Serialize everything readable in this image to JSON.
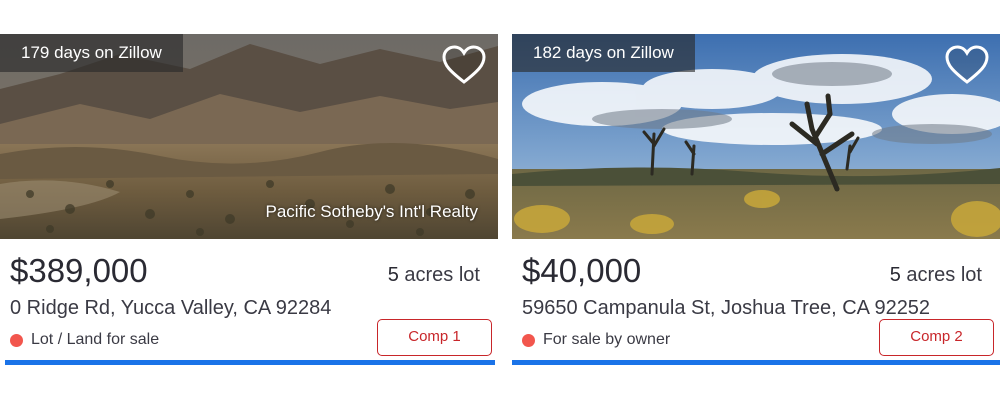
{
  "listings": [
    {
      "days_on_zillow": "179 days on Zillow",
      "attribution": "Pacific Sotheby's Int'l Realty",
      "price": "$389,000",
      "lot_number": "5",
      "lot_unit": " acres lot",
      "address": "0 Ridge Rd, Yucca Valley, CA 92284",
      "status": "Lot / Land for sale",
      "comp_label": "Comp 1",
      "favorite_icon": "heart-outline-icon"
    },
    {
      "days_on_zillow": "182 days on Zillow",
      "price": "$40,000",
      "lot_number": "5",
      "lot_unit": " acres lot",
      "address": "59650 Campanula St, Joshua Tree, CA 92252",
      "status": "For sale by owner",
      "comp_label": "Comp 2",
      "favorite_icon": "heart-outline-icon"
    }
  ],
  "colors": {
    "status_dot": "#f2564d",
    "comp_button": "#c8262a",
    "accent_bar": "#1a73e8",
    "text": "#2a2a33"
  }
}
